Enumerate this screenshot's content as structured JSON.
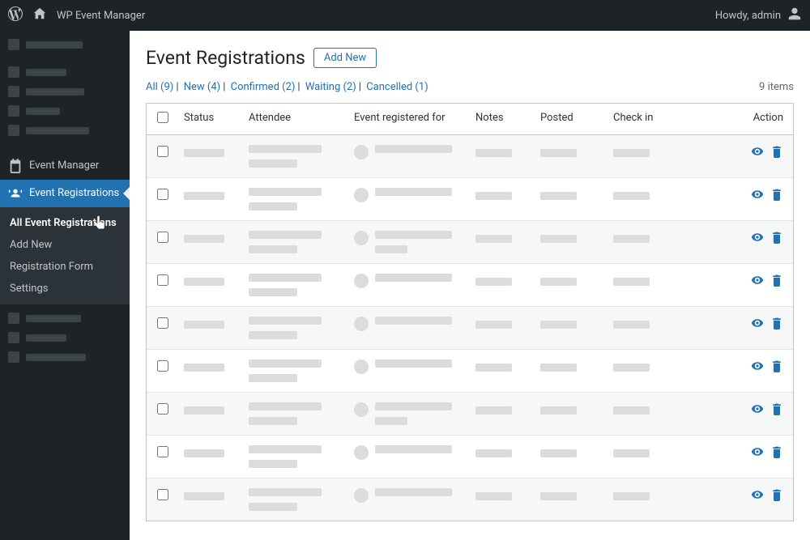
{
  "topbar": {
    "site_title": "WP Event Manager",
    "greeting": "Howdy, admin"
  },
  "sidebar": {
    "event_manager": "Event Manager",
    "event_registrations": "Event Registrations",
    "submenu": {
      "all": "All Event Registrations",
      "add_new": "Add New",
      "registration_form": "Registration Form",
      "settings": "Settings"
    }
  },
  "page": {
    "title": "Event Registrations",
    "add_new": "Add New",
    "items_count": "9 items"
  },
  "filters": {
    "all": "All (9)",
    "new": "New (4)",
    "confirmed": "Confirmed (2)",
    "waiting": "Waiting (2)",
    "cancelled": "Cancelled (1)"
  },
  "columns": {
    "status": "Status",
    "attendee": "Attendee",
    "event": "Event registered for",
    "notes": "Notes",
    "posted": "Posted",
    "check_in": "Check in",
    "action": "Action"
  },
  "rows": [
    {
      "event_lines": 1
    },
    {
      "event_lines": 1
    },
    {
      "event_lines": 2
    },
    {
      "event_lines": 1
    },
    {
      "event_lines": 1
    },
    {
      "event_lines": 1
    },
    {
      "event_lines": 2
    },
    {
      "event_lines": 1
    },
    {
      "event_lines": 1
    }
  ]
}
